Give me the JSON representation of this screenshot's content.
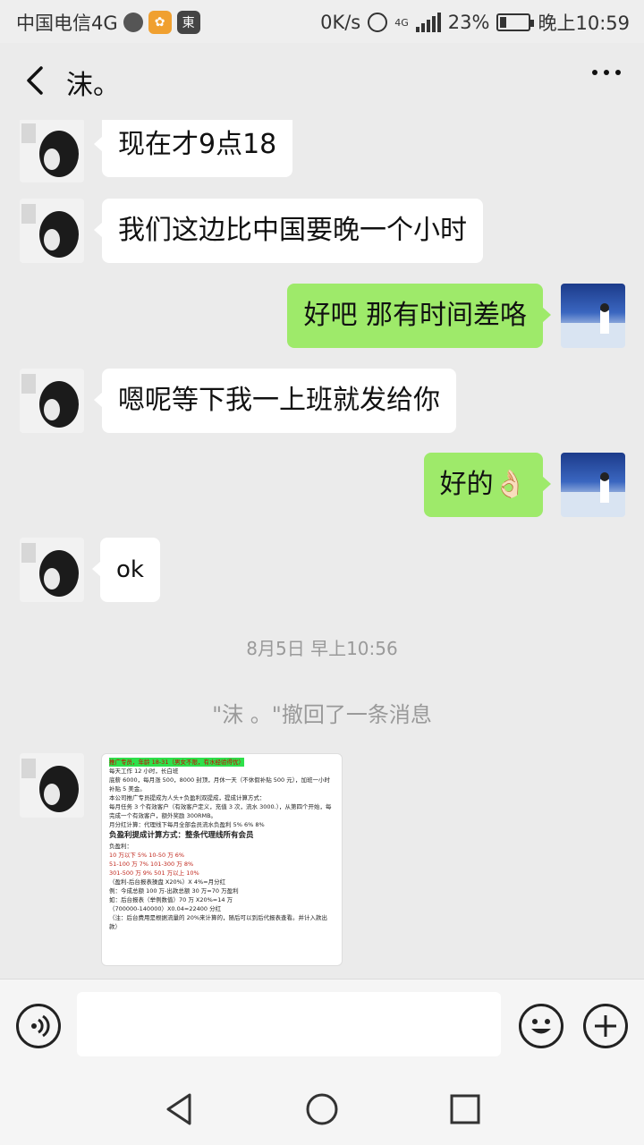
{
  "status": {
    "carrier": "中国电信4G",
    "speed": "0K/s",
    "network": "4G",
    "battery": "23%",
    "battery_level": 0.23,
    "time": "晚上10:59"
  },
  "header": {
    "title": "沫。"
  },
  "messages": [
    {
      "text": "现在才9点18"
    },
    {
      "text": "我们这边比中国要晚一个小时"
    },
    {
      "text": "好吧 那有时间差咯"
    },
    {
      "text": "嗯呢等下我一上班就发给你"
    },
    {
      "text": "好的👌🏻"
    },
    {
      "text": "ok"
    }
  ],
  "system": {
    "timestamp": "8月5日 早上10:56",
    "recall": "\"沫 。\"撤回了一条消息"
  },
  "image_doc": {
    "lines": [
      "推广专员，年龄 18-31（男女不限，有水经验得优）",
      "每天工作 12 小时，长白班",
      "底薪 6000，每月涨 500，8000 封顶，月休一天（不休假补贴 500 元），加班一小时补贴 5 美金。",
      "本公司推广专员提成为人头+负盈利双提成，提成计算方式：",
      "每月任务 3 个有效客户（有效客户定义，充值 3 次，流水 3000.），从第四个开始，每完成一个有效客户，额外奖励 300RMB。",
      "月分红计算：代理线下每月全部会员流水负盈利 5%  6%  8%",
      "负盈利提成计算方式：整条代理线所有会员",
      "负盈利：",
      "10 万以下 5%   10-50 万 6%",
      "51-100 万 7%   101-300 万 8%",
      "301-500 万 9%   501 万以上 10%",
      "（盈利-后台报表操盘 X20%）X 4%=月分红",
      "例：今成总额 100 万-出款总额 30 万=70 万盈利",
      "如：后台报表（举例数值）70 万 X20%=14 万",
      "（700000-140000）X0.04=22400 分红",
      "（注：后台费用是根据流量的 20%来计算的，随后可以到后代报表查看。并计入款出款）"
    ]
  }
}
